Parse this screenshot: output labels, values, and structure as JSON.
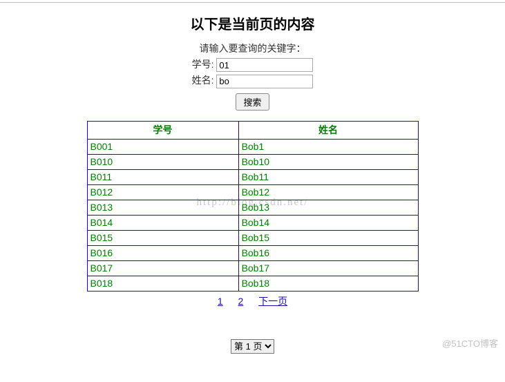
{
  "title": "以下是当前页的内容",
  "form": {
    "prompt": "请输入要查询的关键字：",
    "id_label": "学号:",
    "id_value": "01",
    "name_label": "姓名:",
    "name_value": "bo",
    "search_label": "搜索"
  },
  "table": {
    "headers": [
      "学号",
      "姓名"
    ],
    "rows": [
      {
        "id": "B001",
        "name": "Bob1"
      },
      {
        "id": "B010",
        "name": "Bob10"
      },
      {
        "id": "B011",
        "name": "Bob11"
      },
      {
        "id": "B012",
        "name": "Bob12"
      },
      {
        "id": "B013",
        "name": "Bob13"
      },
      {
        "id": "B014",
        "name": "Bob14"
      },
      {
        "id": "B015",
        "name": "Bob15"
      },
      {
        "id": "B016",
        "name": "Bob16"
      },
      {
        "id": "B017",
        "name": "Bob17"
      },
      {
        "id": "B018",
        "name": "Bob18"
      }
    ]
  },
  "pager": {
    "current": "1",
    "page2": "2",
    "next": "下一页"
  },
  "page_select": {
    "selected": "第 1 页"
  },
  "watermark_blog": "http://blog.csdn.net/",
  "watermark_cto": "@51CTO博客"
}
